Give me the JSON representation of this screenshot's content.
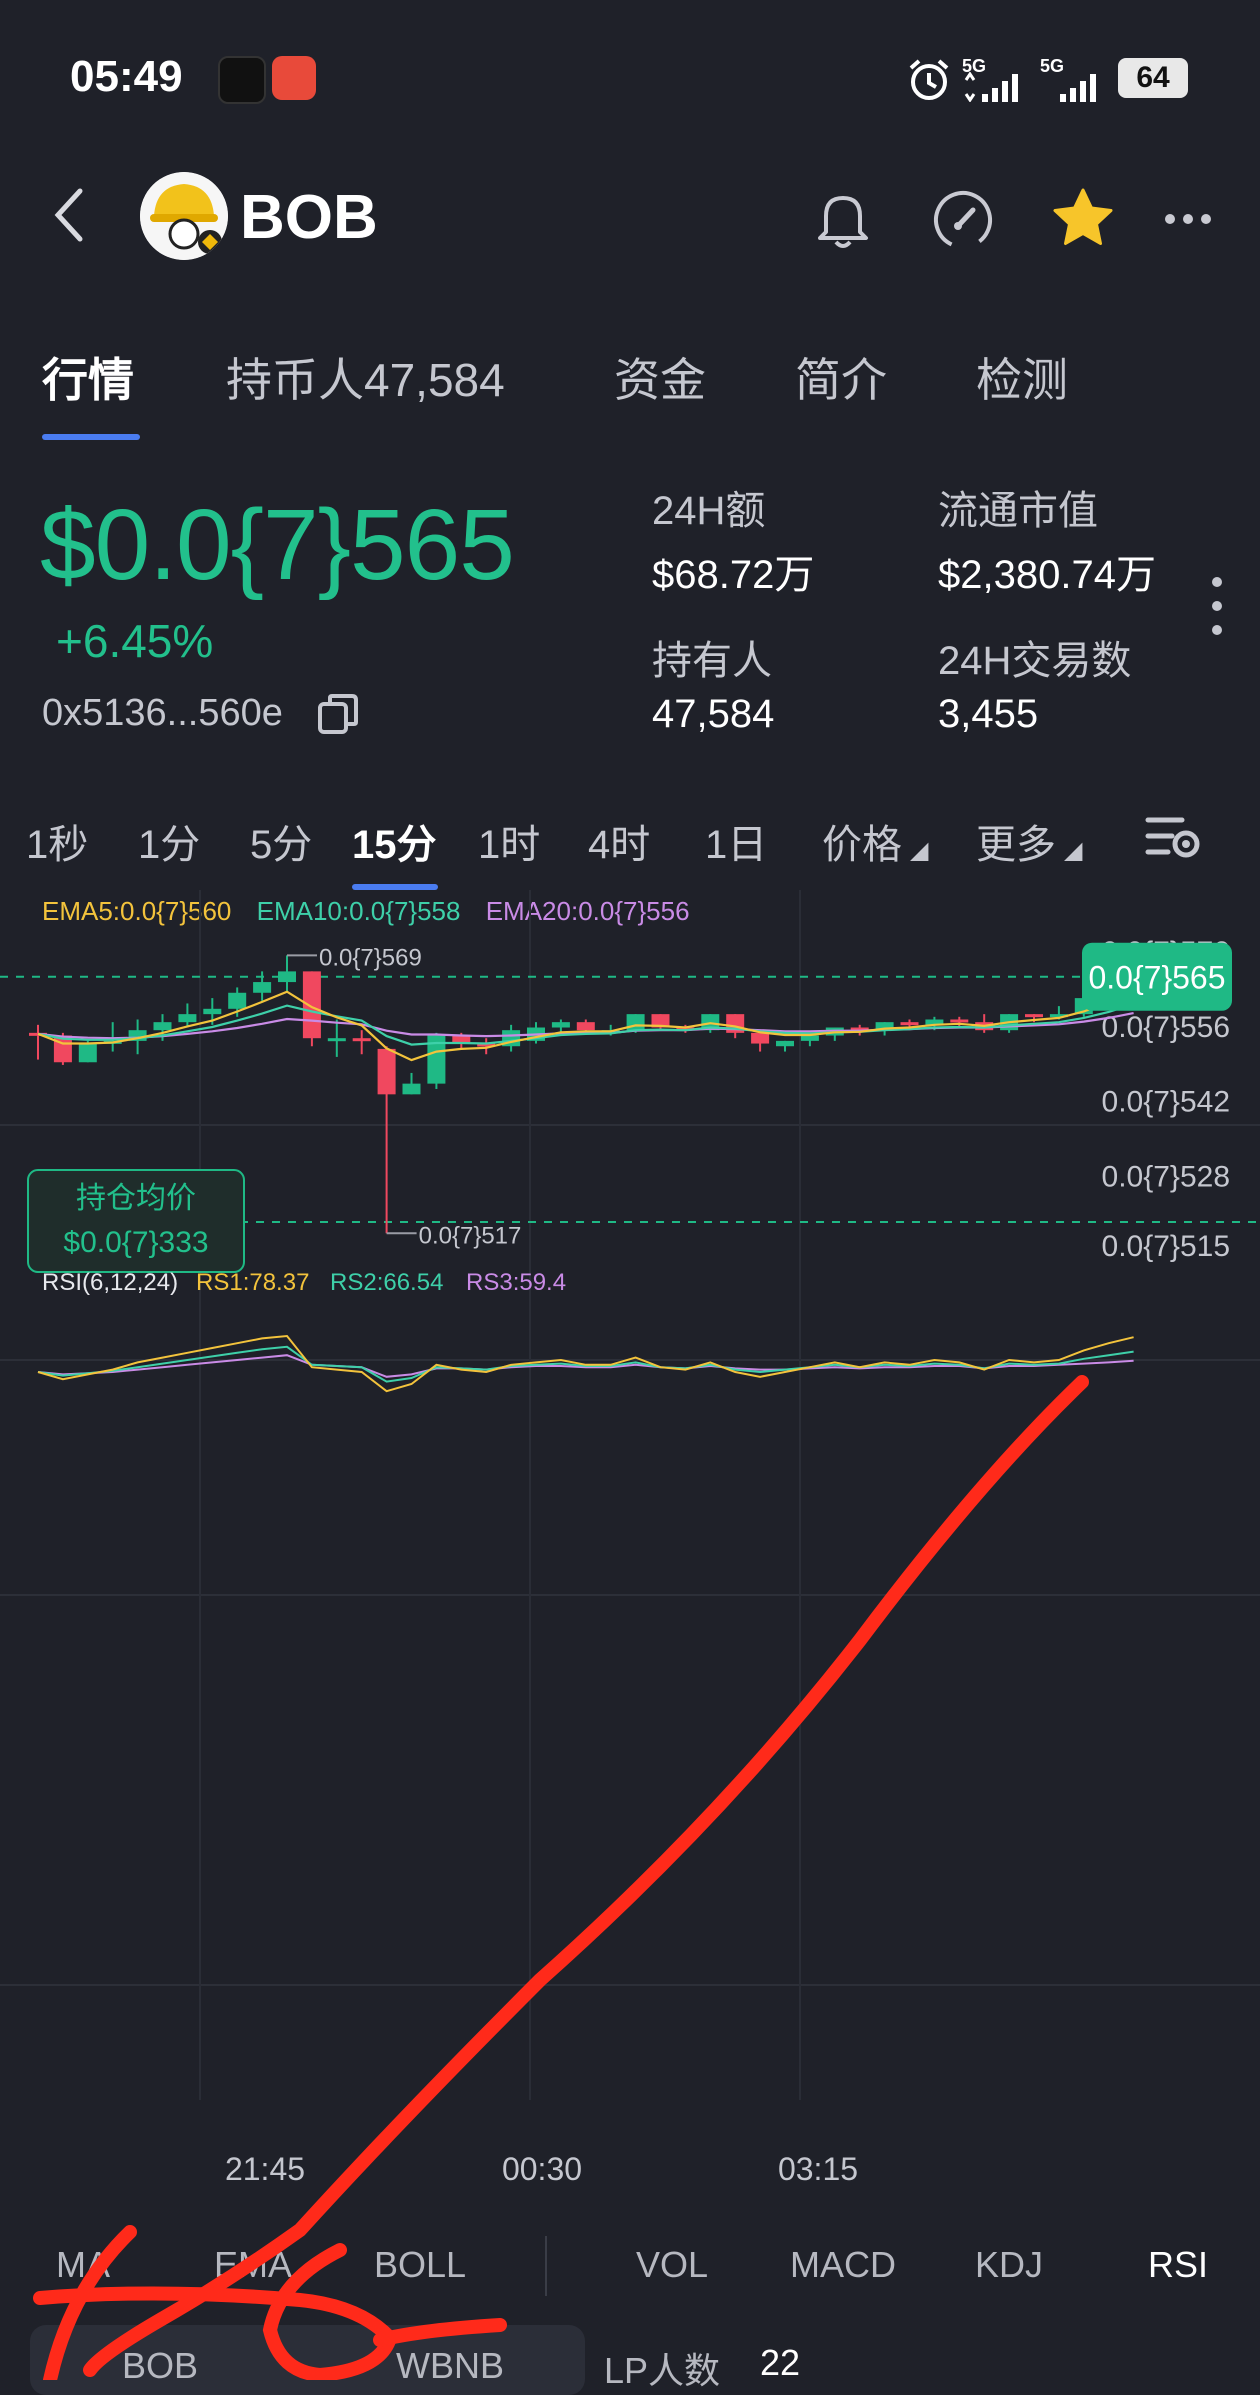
{
  "status_bar": {
    "time": "05:49",
    "network1": "5G",
    "network2": "5G",
    "battery": "64"
  },
  "header": {
    "token": "BOB"
  },
  "tabs": [
    {
      "label": "行情",
      "active": true
    },
    {
      "label": "持币人47,584",
      "active": false
    },
    {
      "label": "资金",
      "active": false
    },
    {
      "label": "简介",
      "active": false
    },
    {
      "label": "检测",
      "active": false
    }
  ],
  "summary": {
    "price": "$0.0{7}565",
    "change": "+6.45%",
    "address": "0x5136...560e",
    "stats": [
      {
        "label": "24H额",
        "value": "$68.72万"
      },
      {
        "label": "流通市值",
        "value": "$2,380.74万"
      },
      {
        "label": "持有人",
        "value": "47,584"
      },
      {
        "label": "24H交易数",
        "value": "3,455"
      }
    ]
  },
  "intervals": [
    {
      "label": "1秒",
      "active": false
    },
    {
      "label": "1分",
      "active": false
    },
    {
      "label": "5分",
      "active": false
    },
    {
      "label": "15分",
      "active": true
    },
    {
      "label": "1时",
      "active": false
    },
    {
      "label": "4时",
      "active": false
    },
    {
      "label": "1日",
      "active": false
    },
    {
      "label": "价格",
      "active": false
    },
    {
      "label": "更多",
      "active": false
    }
  ],
  "ema_legend": {
    "ema5": "EMA5:0.0{7}560",
    "ema10": "EMA10:0.0{7}558",
    "ema20": "EMA20:0.0{7}556"
  },
  "chart": {
    "high_label": "0.0{7}569",
    "low_label": "0.0{7}517",
    "current_tag": "0.0{7}565",
    "avg_cost_label": "持仓均价",
    "avg_cost_value": "$0.0{7}333",
    "rsi_legend": {
      "name": "RSI(6,12,24)",
      "rs1": "RS1:78.37",
      "rs2": "RS2:66.54",
      "rs3": "RS3:59.4"
    }
  },
  "chart_data": {
    "type": "candlestick",
    "y_tick_labels": [
      "0.0{7}570",
      "0.0{7}556",
      "0.0{7}542",
      "0.0{7}528",
      "0.0{7}515"
    ],
    "x_tick_labels": [
      "21:45",
      "00:30",
      "03:15"
    ],
    "ylim": [
      513,
      571
    ],
    "candles": [
      {
        "o": 554.5,
        "h": 556.0,
        "l": 549.5,
        "c": 554.0
      },
      {
        "o": 554.0,
        "h": 554.5,
        "l": 548.5,
        "c": 549.0
      },
      {
        "o": 549.0,
        "h": 553.0,
        "l": 549.0,
        "c": 552.5
      },
      {
        "o": 552.5,
        "h": 556.5,
        "l": 551.0,
        "c": 553.0
      },
      {
        "o": 553.0,
        "h": 557.0,
        "l": 550.5,
        "c": 555.0
      },
      {
        "o": 555.0,
        "h": 558.0,
        "l": 553.0,
        "c": 556.5
      },
      {
        "o": 556.5,
        "h": 560.0,
        "l": 555.5,
        "c": 558.0
      },
      {
        "o": 558.0,
        "h": 561.0,
        "l": 556.0,
        "c": 559.0
      },
      {
        "o": 559.0,
        "h": 563.0,
        "l": 557.5,
        "c": 562.0
      },
      {
        "o": 562.0,
        "h": 566.0,
        "l": 560.5,
        "c": 564.0
      },
      {
        "o": 564.0,
        "h": 569.0,
        "l": 562.0,
        "c": 566.0
      },
      {
        "o": 566.0,
        "h": 566.0,
        "l": 552.0,
        "c": 553.5
      },
      {
        "o": 553.5,
        "h": 557.0,
        "l": 550.0,
        "c": 553.5
      },
      {
        "o": 553.5,
        "h": 555.0,
        "l": 550.5,
        "c": 553.0
      },
      {
        "o": 551.5,
        "h": 552.0,
        "l": 517.0,
        "c": 543.0
      },
      {
        "o": 543.0,
        "h": 547.0,
        "l": 543.0,
        "c": 545.0
      },
      {
        "o": 545.0,
        "h": 554.5,
        "l": 544.0,
        "c": 554.0
      },
      {
        "o": 554.0,
        "h": 554.5,
        "l": 551.5,
        "c": 552.5
      },
      {
        "o": 552.5,
        "h": 553.5,
        "l": 550.5,
        "c": 552.0
      },
      {
        "o": 552.0,
        "h": 556.0,
        "l": 551.0,
        "c": 555.0
      },
      {
        "o": 553.0,
        "h": 556.5,
        "l": 552.5,
        "c": 555.5
      },
      {
        "o": 555.5,
        "h": 557.0,
        "l": 554.5,
        "c": 556.5
      },
      {
        "o": 556.5,
        "h": 557.0,
        "l": 554.5,
        "c": 555.0
      },
      {
        "o": 555.0,
        "h": 556.0,
        "l": 554.0,
        "c": 555.0
      },
      {
        "o": 555.0,
        "h": 558.0,
        "l": 554.5,
        "c": 558.0
      },
      {
        "o": 558.0,
        "h": 558.0,
        "l": 555.0,
        "c": 555.5
      },
      {
        "o": 555.5,
        "h": 556.0,
        "l": 554.5,
        "c": 555.0
      },
      {
        "o": 555.0,
        "h": 558.0,
        "l": 554.5,
        "c": 558.0
      },
      {
        "o": 558.0,
        "h": 558.0,
        "l": 553.5,
        "c": 554.5
      },
      {
        "o": 554.5,
        "h": 555.0,
        "l": 551.0,
        "c": 552.5
      },
      {
        "o": 552.0,
        "h": 553.0,
        "l": 551.0,
        "c": 553.0
      },
      {
        "o": 553.0,
        "h": 554.5,
        "l": 552.0,
        "c": 554.0
      },
      {
        "o": 554.0,
        "h": 555.5,
        "l": 553.0,
        "c": 555.5
      },
      {
        "o": 555.5,
        "h": 556.0,
        "l": 554.0,
        "c": 555.0
      },
      {
        "o": 555.0,
        "h": 556.5,
        "l": 554.0,
        "c": 556.5
      },
      {
        "o": 556.5,
        "h": 557.0,
        "l": 555.0,
        "c": 556.0
      },
      {
        "o": 556.0,
        "h": 557.5,
        "l": 555.0,
        "c": 557.0
      },
      {
        "o": 557.0,
        "h": 557.5,
        "l": 555.5,
        "c": 556.5
      },
      {
        "o": 556.5,
        "h": 558.0,
        "l": 554.5,
        "c": 555.0
      },
      {
        "o": 555.0,
        "h": 558.0,
        "l": 554.5,
        "c": 558.0
      },
      {
        "o": 558.0,
        "h": 558.0,
        "l": 556.5,
        "c": 557.5
      },
      {
        "o": 557.5,
        "h": 559.5,
        "l": 557.0,
        "c": 558.0
      },
      {
        "o": 558.0,
        "h": 561.5,
        "l": 557.5,
        "c": 561.0
      },
      {
        "o": 561.0,
        "h": 564.5,
        "l": 560.0,
        "c": 563.5
      },
      {
        "o": 563.5,
        "h": 567.5,
        "l": 562.0,
        "c": 566.5
      }
    ],
    "ema5": [
      554.3,
      552.5,
      552.5,
      552.7,
      553.5,
      554.5,
      555.7,
      556.8,
      558.5,
      560.3,
      562.2,
      559.3,
      557.4,
      555.9,
      551.6,
      549.4,
      551.0,
      551.5,
      551.7,
      552.8,
      553.7,
      554.6,
      554.8,
      554.8,
      555.9,
      555.8,
      555.5,
      556.3,
      555.7,
      554.6,
      554.1,
      554.1,
      554.6,
      554.7,
      555.3,
      555.5,
      556.0,
      556.2,
      555.8,
      556.5,
      556.9,
      557.3,
      558.5,
      560.2,
      562.3
    ],
    "ema10": [
      554.3,
      553.4,
      553.2,
      553.2,
      553.5,
      554.0,
      554.8,
      555.6,
      556.8,
      558.1,
      559.6,
      558.5,
      557.6,
      556.8,
      553.9,
      552.3,
      552.6,
      552.6,
      552.5,
      553.0,
      553.5,
      554.1,
      554.3,
      554.4,
      555.0,
      555.1,
      555.0,
      555.5,
      555.3,
      554.8,
      554.5,
      554.4,
      554.6,
      554.7,
      555.0,
      555.2,
      555.5,
      555.6,
      555.5,
      555.9,
      556.2,
      556.5,
      557.3,
      558.4,
      559.9
    ],
    "ema20": [
      554.3,
      553.8,
      553.6,
      553.5,
      553.6,
      553.9,
      554.3,
      554.8,
      555.4,
      556.2,
      557.1,
      556.8,
      556.4,
      556.1,
      554.9,
      554.2,
      554.2,
      554.0,
      553.9,
      554.0,
      554.2,
      554.4,
      554.5,
      554.5,
      554.9,
      555.0,
      555.0,
      555.3,
      555.2,
      555.0,
      554.8,
      554.8,
      554.9,
      554.9,
      555.1,
      555.2,
      555.4,
      555.5,
      555.5,
      555.7,
      555.9,
      556.1,
      556.6,
      557.3,
      558.2
    ],
    "rsi1": [
      50,
      44,
      48,
      52,
      58,
      62,
      66,
      70,
      74,
      78,
      80,
      54,
      52,
      50,
      34,
      40,
      56,
      52,
      50,
      56,
      58,
      60,
      56,
      56,
      62,
      54,
      52,
      58,
      50,
      46,
      50,
      54,
      58,
      54,
      58,
      56,
      60,
      58,
      52,
      60,
      58,
      60,
      68,
      74,
      79
    ],
    "rsi2": [
      50,
      47,
      49,
      51,
      54,
      57,
      60,
      63,
      66,
      69,
      71,
      56,
      55,
      54,
      42,
      45,
      54,
      53,
      52,
      55,
      56,
      57,
      55,
      55,
      58,
      54,
      53,
      56,
      52,
      50,
      52,
      54,
      56,
      54,
      56,
      55,
      57,
      56,
      53,
      57,
      56,
      57,
      61,
      64,
      67
    ],
    "rsi3": [
      50,
      48,
      49,
      50,
      52,
      54,
      56,
      58,
      60,
      62,
      64,
      56,
      55,
      54,
      46,
      48,
      53,
      53,
      52,
      54,
      55,
      55,
      54,
      54,
      56,
      54,
      53,
      55,
      53,
      52,
      52,
      53,
      54,
      53,
      54,
      54,
      55,
      55,
      53,
      55,
      55,
      56,
      57,
      58,
      59.4
    ],
    "colors": {
      "up": "#1fb985",
      "down": "#f0485f",
      "ema5": "#f3c33c",
      "ema10": "#3ed0a9",
      "ema20": "#c98be6",
      "rs1": "#f3c33c",
      "rs2": "#3ed0a9",
      "rs3": "#c98be6"
    }
  },
  "indicator_tabs": [
    {
      "label": "MA",
      "active": false
    },
    {
      "label": "EMA",
      "active": false
    },
    {
      "label": "BOLL",
      "active": false
    },
    {
      "label": "VOL",
      "active": false
    },
    {
      "label": "MACD",
      "active": false
    },
    {
      "label": "KDJ",
      "active": false
    },
    {
      "label": "RSI",
      "active": true
    }
  ],
  "bottom": {
    "pair_left": "BOB",
    "pair_right": "WBNB",
    "lp_label": "LP人数",
    "lp_value": "22"
  }
}
